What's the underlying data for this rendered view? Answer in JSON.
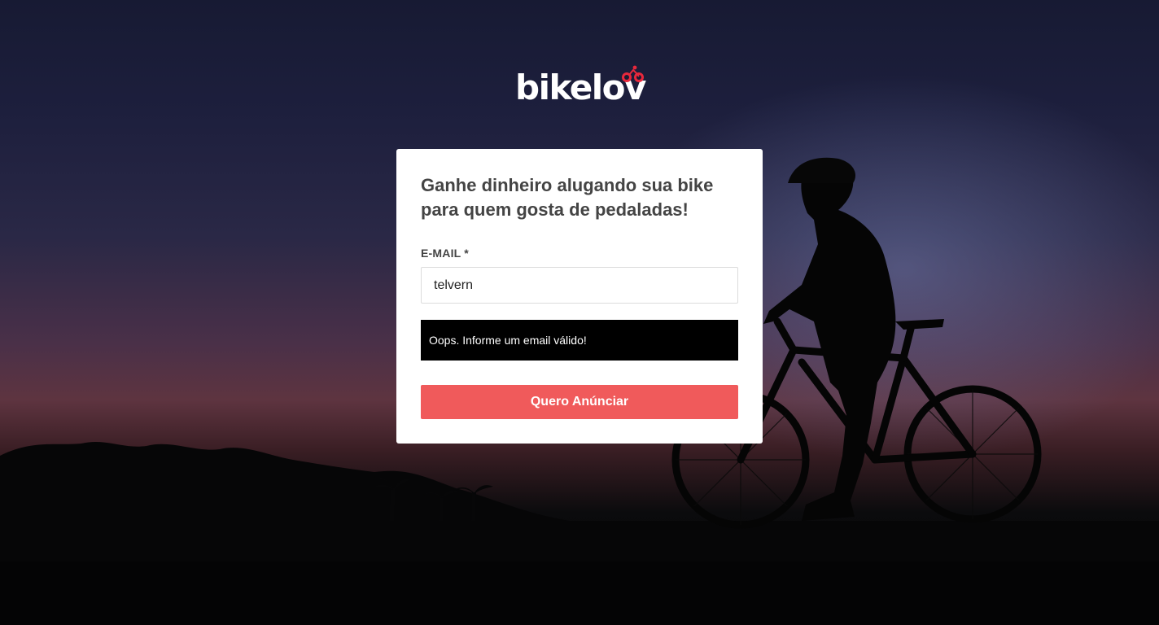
{
  "brand": {
    "name": "bikelov",
    "accent_color": "#e8283c"
  },
  "card": {
    "headline": "Ganhe dinheiro alugando sua bike para quem gosta de pedaladas!",
    "email": {
      "label": "E-MAIL *",
      "value": "telvern"
    },
    "error": "Oops. Informe um email válido!",
    "submit_label": "Quero Anúnciar",
    "submit_color": "#f05a5b"
  },
  "background": {
    "icon": "cyclist-silhouette-sunset-photo"
  }
}
